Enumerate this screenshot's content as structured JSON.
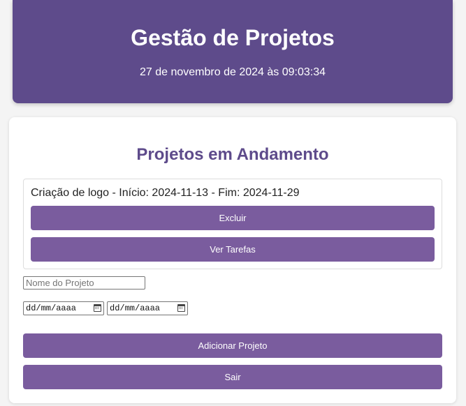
{
  "header": {
    "title": "Gestão de Projetos",
    "datetime": "27 de novembro de 2024 às 09:03:34"
  },
  "main": {
    "section_title": "Projetos em Andamento",
    "projects": [
      {
        "summary": "Criação de logo - Início: 2024-11-13 - Fim: 2024-11-29",
        "delete_label": "Excluir",
        "tasks_label": "Ver Tarefas"
      }
    ],
    "form": {
      "name_placeholder": "Nome do Projeto",
      "start_date_placeholder": "dd/mm/aaaa",
      "end_date_placeholder": "dd/mm/aaaa",
      "add_label": "Adicionar Projeto",
      "exit_label": "Sair"
    }
  },
  "colors": {
    "header_bg": "#5e4b8b",
    "accent": "#7a5c9e",
    "title_color": "#5e4b8b"
  },
  "icons": {
    "date_picker": "calendar-icon"
  }
}
